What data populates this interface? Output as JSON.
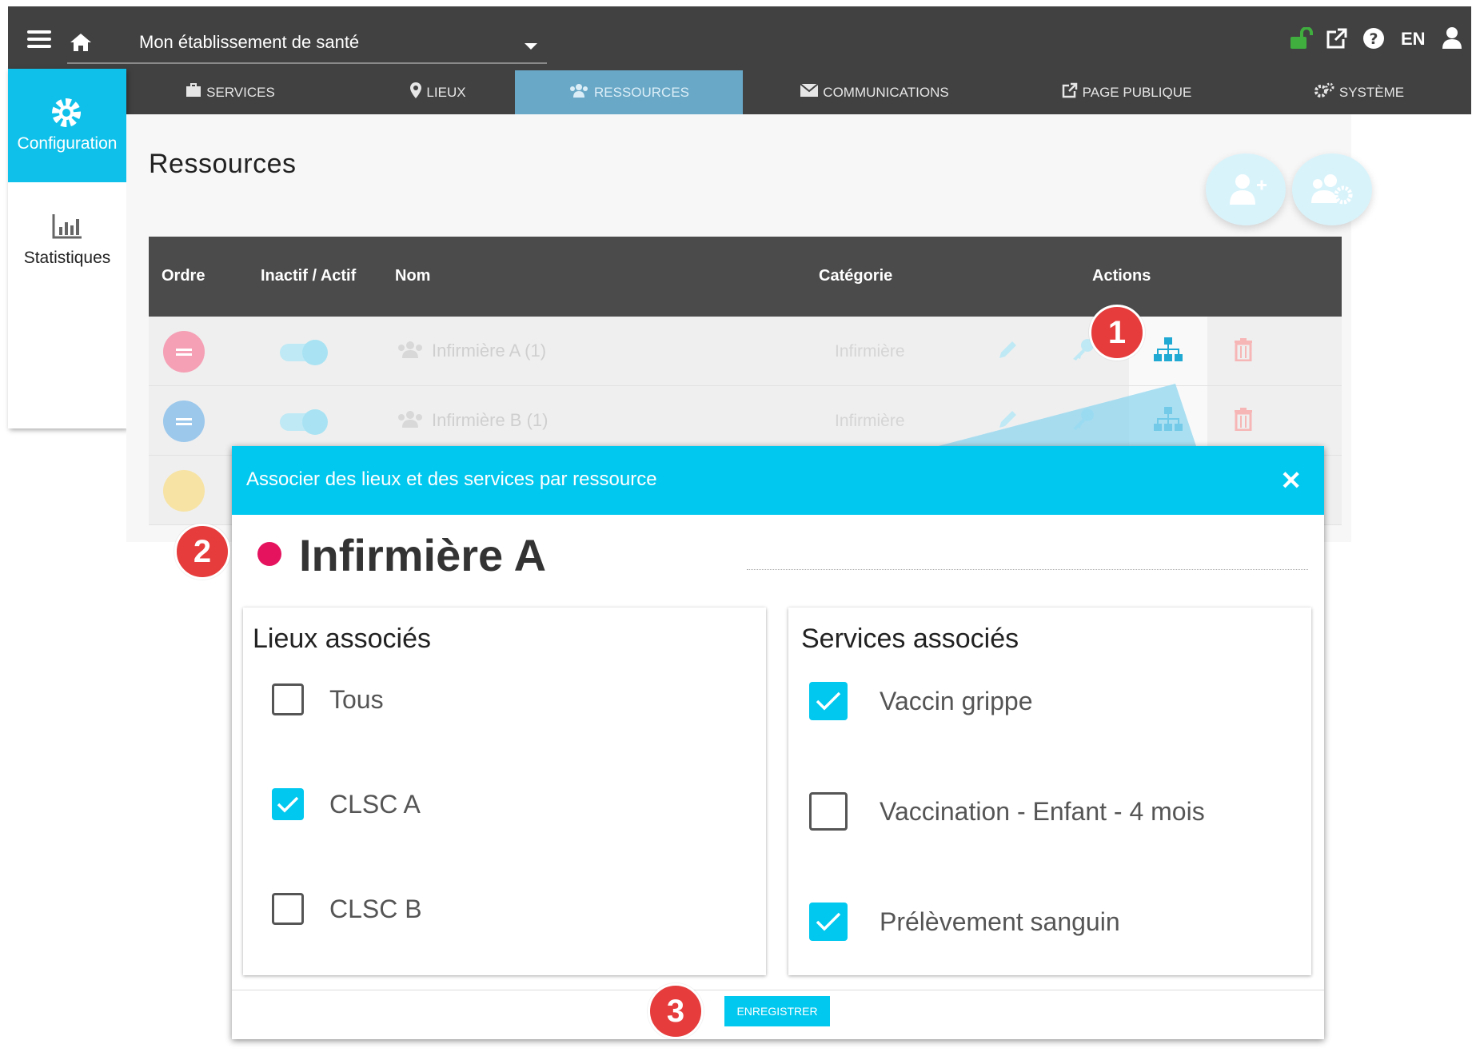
{
  "topbar": {
    "establishment": "Mon établissement de santé",
    "language": "EN"
  },
  "nav": {
    "tabs": [
      {
        "label": "SERVICES"
      },
      {
        "label": "LIEUX"
      },
      {
        "label": "RESSOURCES"
      },
      {
        "label": "COMMUNICATIONS"
      },
      {
        "label": "PAGE PUBLIQUE"
      },
      {
        "label": "SYSTÈME"
      }
    ]
  },
  "sidebar": {
    "items": [
      {
        "label": "Configuration"
      },
      {
        "label": "Statistiques"
      }
    ]
  },
  "page": {
    "title": "Ressources"
  },
  "table": {
    "columns": [
      "Ordre",
      "Inactif / Actif",
      "Nom",
      "Catégorie",
      "Actions"
    ],
    "rows": [
      {
        "name": "Infirmière A (1)",
        "category": "Infirmière",
        "color": "#f5a0b5"
      },
      {
        "name": "Infirmière B (1)",
        "category": "Infirmière",
        "color": "#9cc8ec"
      }
    ]
  },
  "dialog": {
    "title": "Associer des lieux et des services par ressource",
    "resource_name": "Infirmière A",
    "resource_color": "#e5135e",
    "lieux": {
      "title": "Lieux associés",
      "items": [
        {
          "label": "Tous",
          "checked": false
        },
        {
          "label": "CLSC A",
          "checked": true
        },
        {
          "label": "CLSC B",
          "checked": false
        }
      ]
    },
    "services": {
      "title": "Services associés",
      "items": [
        {
          "label": "Vaccin grippe",
          "checked": true
        },
        {
          "label": "Vaccination - Enfant - 4 mois",
          "checked": false
        },
        {
          "label": "Prélèvement sanguin",
          "checked": true
        }
      ]
    },
    "save_label": "ENREGISTRER"
  },
  "callouts": [
    "1",
    "2",
    "3"
  ],
  "colors": {
    "accent": "#00c8ef",
    "topbar": "#414141",
    "callout": "#e63c3c"
  }
}
